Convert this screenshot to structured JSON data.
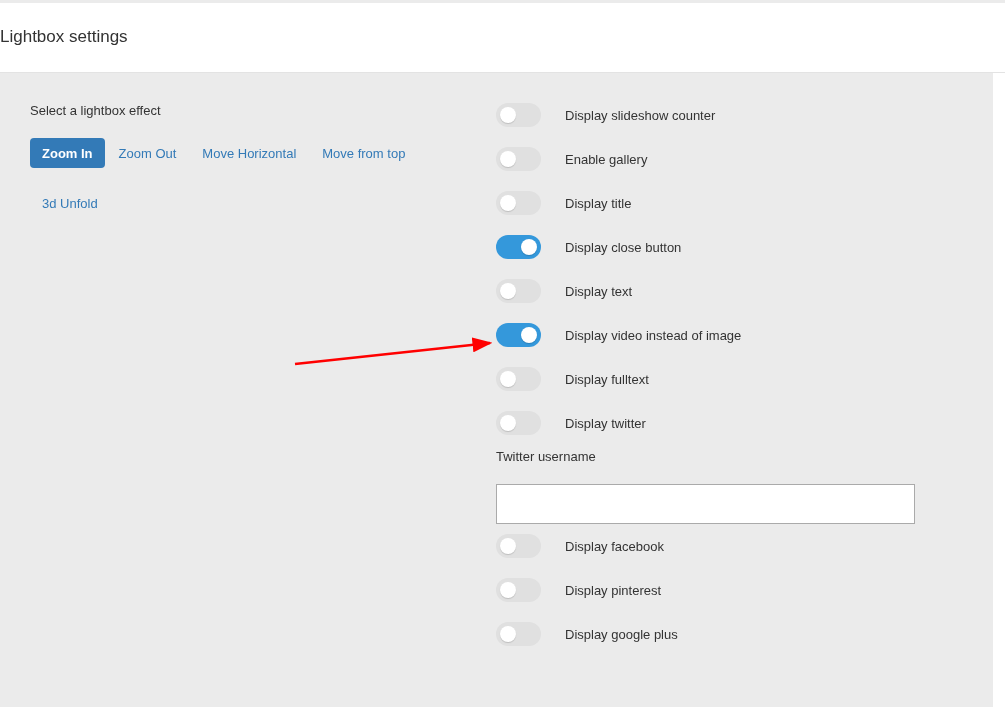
{
  "header": {
    "title": "Lightbox settings"
  },
  "effects": {
    "label": "Select a lightbox effect",
    "options": [
      {
        "label": "Zoom In",
        "selected": true
      },
      {
        "label": "Zoom Out",
        "selected": false
      },
      {
        "label": "Move Horizontal",
        "selected": false
      },
      {
        "label": "Move from top",
        "selected": false
      },
      {
        "label": "3d Unfold",
        "selected": false
      }
    ]
  },
  "settings": [
    {
      "kind": "toggle",
      "label": "Display slideshow counter",
      "on": false
    },
    {
      "kind": "toggle",
      "label": "Enable gallery",
      "on": false
    },
    {
      "kind": "toggle",
      "label": "Display title",
      "on": false
    },
    {
      "kind": "toggle",
      "label": "Display close button",
      "on": true
    },
    {
      "kind": "toggle",
      "label": "Display text",
      "on": false
    },
    {
      "kind": "toggle",
      "label": "Display video instead of image",
      "on": true
    },
    {
      "kind": "toggle",
      "label": "Display fulltext",
      "on": false
    },
    {
      "kind": "toggle",
      "label": "Display twitter",
      "on": false
    },
    {
      "kind": "text_field",
      "label": "Twitter username"
    },
    {
      "kind": "toggle",
      "label": "Display facebook",
      "on": false
    },
    {
      "kind": "toggle",
      "label": "Display pinterest",
      "on": false
    },
    {
      "kind": "toggle",
      "label": "Display google plus",
      "on": false
    }
  ]
}
